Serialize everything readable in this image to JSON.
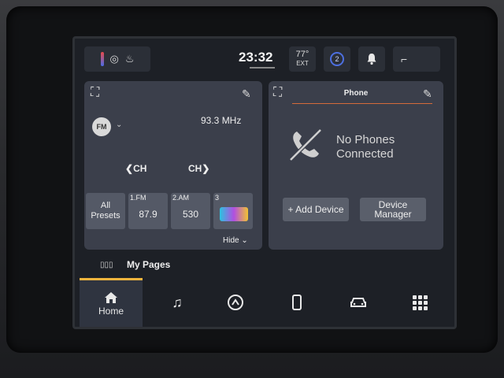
{
  "statusbar": {
    "clock": "23:32",
    "temperature": "77°",
    "temperature_unit": "EXT",
    "icons": [
      "temperature-gauge-icon",
      "steering-wheel-heat-icon",
      "seat-heat-icon",
      "user-profile-icon",
      "notification-bell-icon",
      "seat-icon"
    ]
  },
  "radio": {
    "band": "FM",
    "frequency": "93.3 MHz",
    "ch_prev": "CH",
    "ch_next": "CH",
    "presets": [
      {
        "label": "",
        "value": "All Presets"
      },
      {
        "label": "1.FM",
        "value": "87.9"
      },
      {
        "label": "2.AM",
        "value": "530"
      },
      {
        "label": "3",
        "value": "",
        "logo": true
      }
    ],
    "hide_label": "Hide"
  },
  "phone": {
    "title": "Phone",
    "status_line1": "No Phones",
    "status_line2": "Connected",
    "add_device": "+ Add Device",
    "device_manager": "Device Manager",
    "accent_color": "#d46a3a"
  },
  "mypages": {
    "label": "My Pages"
  },
  "nav": {
    "home_label": "Home",
    "active_color": "#f1b43d",
    "items": [
      "home-icon",
      "music-icon",
      "driving-mode-icon",
      "phone-device-icon",
      "vehicle-icon",
      "apps-grid-icon"
    ]
  }
}
